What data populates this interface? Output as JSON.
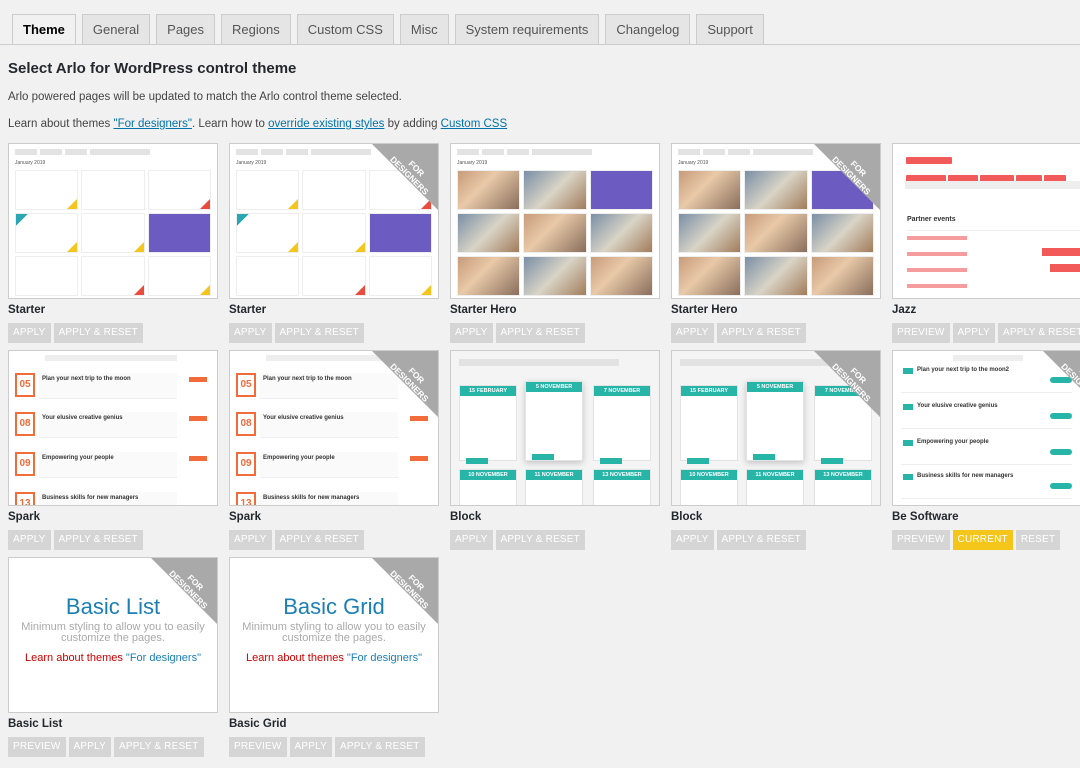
{
  "tabs": [
    "Theme",
    "General",
    "Pages",
    "Regions",
    "Custom CSS",
    "Misc",
    "System requirements",
    "Changelog",
    "Support"
  ],
  "heading": "Select Arlo for WordPress control theme",
  "intro": "Arlo powered pages will be updated to match the Arlo control theme selected.",
  "learn": {
    "prefix": "Learn about themes ",
    "link1": "\"For designers\"",
    "mid": ". Learn how to ",
    "link2": "override existing styles",
    "mid2": " by adding ",
    "link3": "Custom CSS"
  },
  "ribbon_text": "FOR DESIGNERS",
  "themes": [
    {
      "name": "Starter",
      "buttons": [
        "APPLY",
        "APPLY & RESET"
      ]
    },
    {
      "name": "Starter",
      "buttons": [
        "APPLY",
        "APPLY & RESET"
      ]
    },
    {
      "name": "Starter Hero",
      "buttons": [
        "APPLY",
        "APPLY & RESET"
      ]
    },
    {
      "name": "Starter Hero",
      "buttons": [
        "APPLY",
        "APPLY & RESET"
      ]
    },
    {
      "name": "Jazz",
      "buttons": [
        "PREVIEW",
        "APPLY",
        "APPLY & RESET"
      ]
    },
    {
      "name": "Spark",
      "buttons": [
        "APPLY",
        "APPLY & RESET"
      ]
    },
    {
      "name": "Spark",
      "buttons": [
        "APPLY",
        "APPLY & RESET"
      ]
    },
    {
      "name": "Block",
      "buttons": [
        "APPLY",
        "APPLY & RESET"
      ]
    },
    {
      "name": "Block",
      "buttons": [
        "APPLY",
        "APPLY & RESET"
      ]
    },
    {
      "name": "Be Software",
      "buttons": [
        "PREVIEW",
        "CURRENT",
        "RESET"
      ]
    },
    {
      "name": "Basic List",
      "buttons": [
        "PREVIEW",
        "APPLY",
        "APPLY & RESET"
      ]
    },
    {
      "name": "Basic Grid",
      "buttons": [
        "PREVIEW",
        "APPLY",
        "APPLY & RESET"
      ]
    }
  ],
  "basic_list": {
    "title": "Basic List",
    "sub": "Minimum styling to allow you to easily customize the pages.",
    "learn": "Learn about themes ",
    "learn_link": "\"For designers\""
  },
  "basic_grid": {
    "title": "Basic Grid",
    "sub": "Minimum styling to allow you to easily customize the pages.",
    "learn": "Learn about themes ",
    "learn_link": "\"For designers\""
  },
  "mock": {
    "starter_month": "January 2019",
    "spark_items": [
      "Plan your next trip to the moon",
      "Your elusive creative genius",
      "Empowering your people",
      "Business skills for new managers"
    ],
    "spark_nums": [
      "05",
      "08",
      "09",
      "13"
    ],
    "block_dates": [
      "15 FEBRUARY",
      "5 NOVEMBER",
      "7 NOVEMBER",
      "10 NOVEMBER",
      "11 NOVEMBER",
      "13 NOVEMBER"
    ],
    "bs_items": [
      "Plan your next trip to the moon2",
      "Your elusive creative genius",
      "Empowering your people",
      "Business skills for new managers"
    ],
    "jazz_heading": "Partner events"
  },
  "colors": {
    "accent": "#f4c51b",
    "teal": "#27b5a8",
    "orange": "#f26b3a",
    "ribbon": "#a9a9a9"
  }
}
